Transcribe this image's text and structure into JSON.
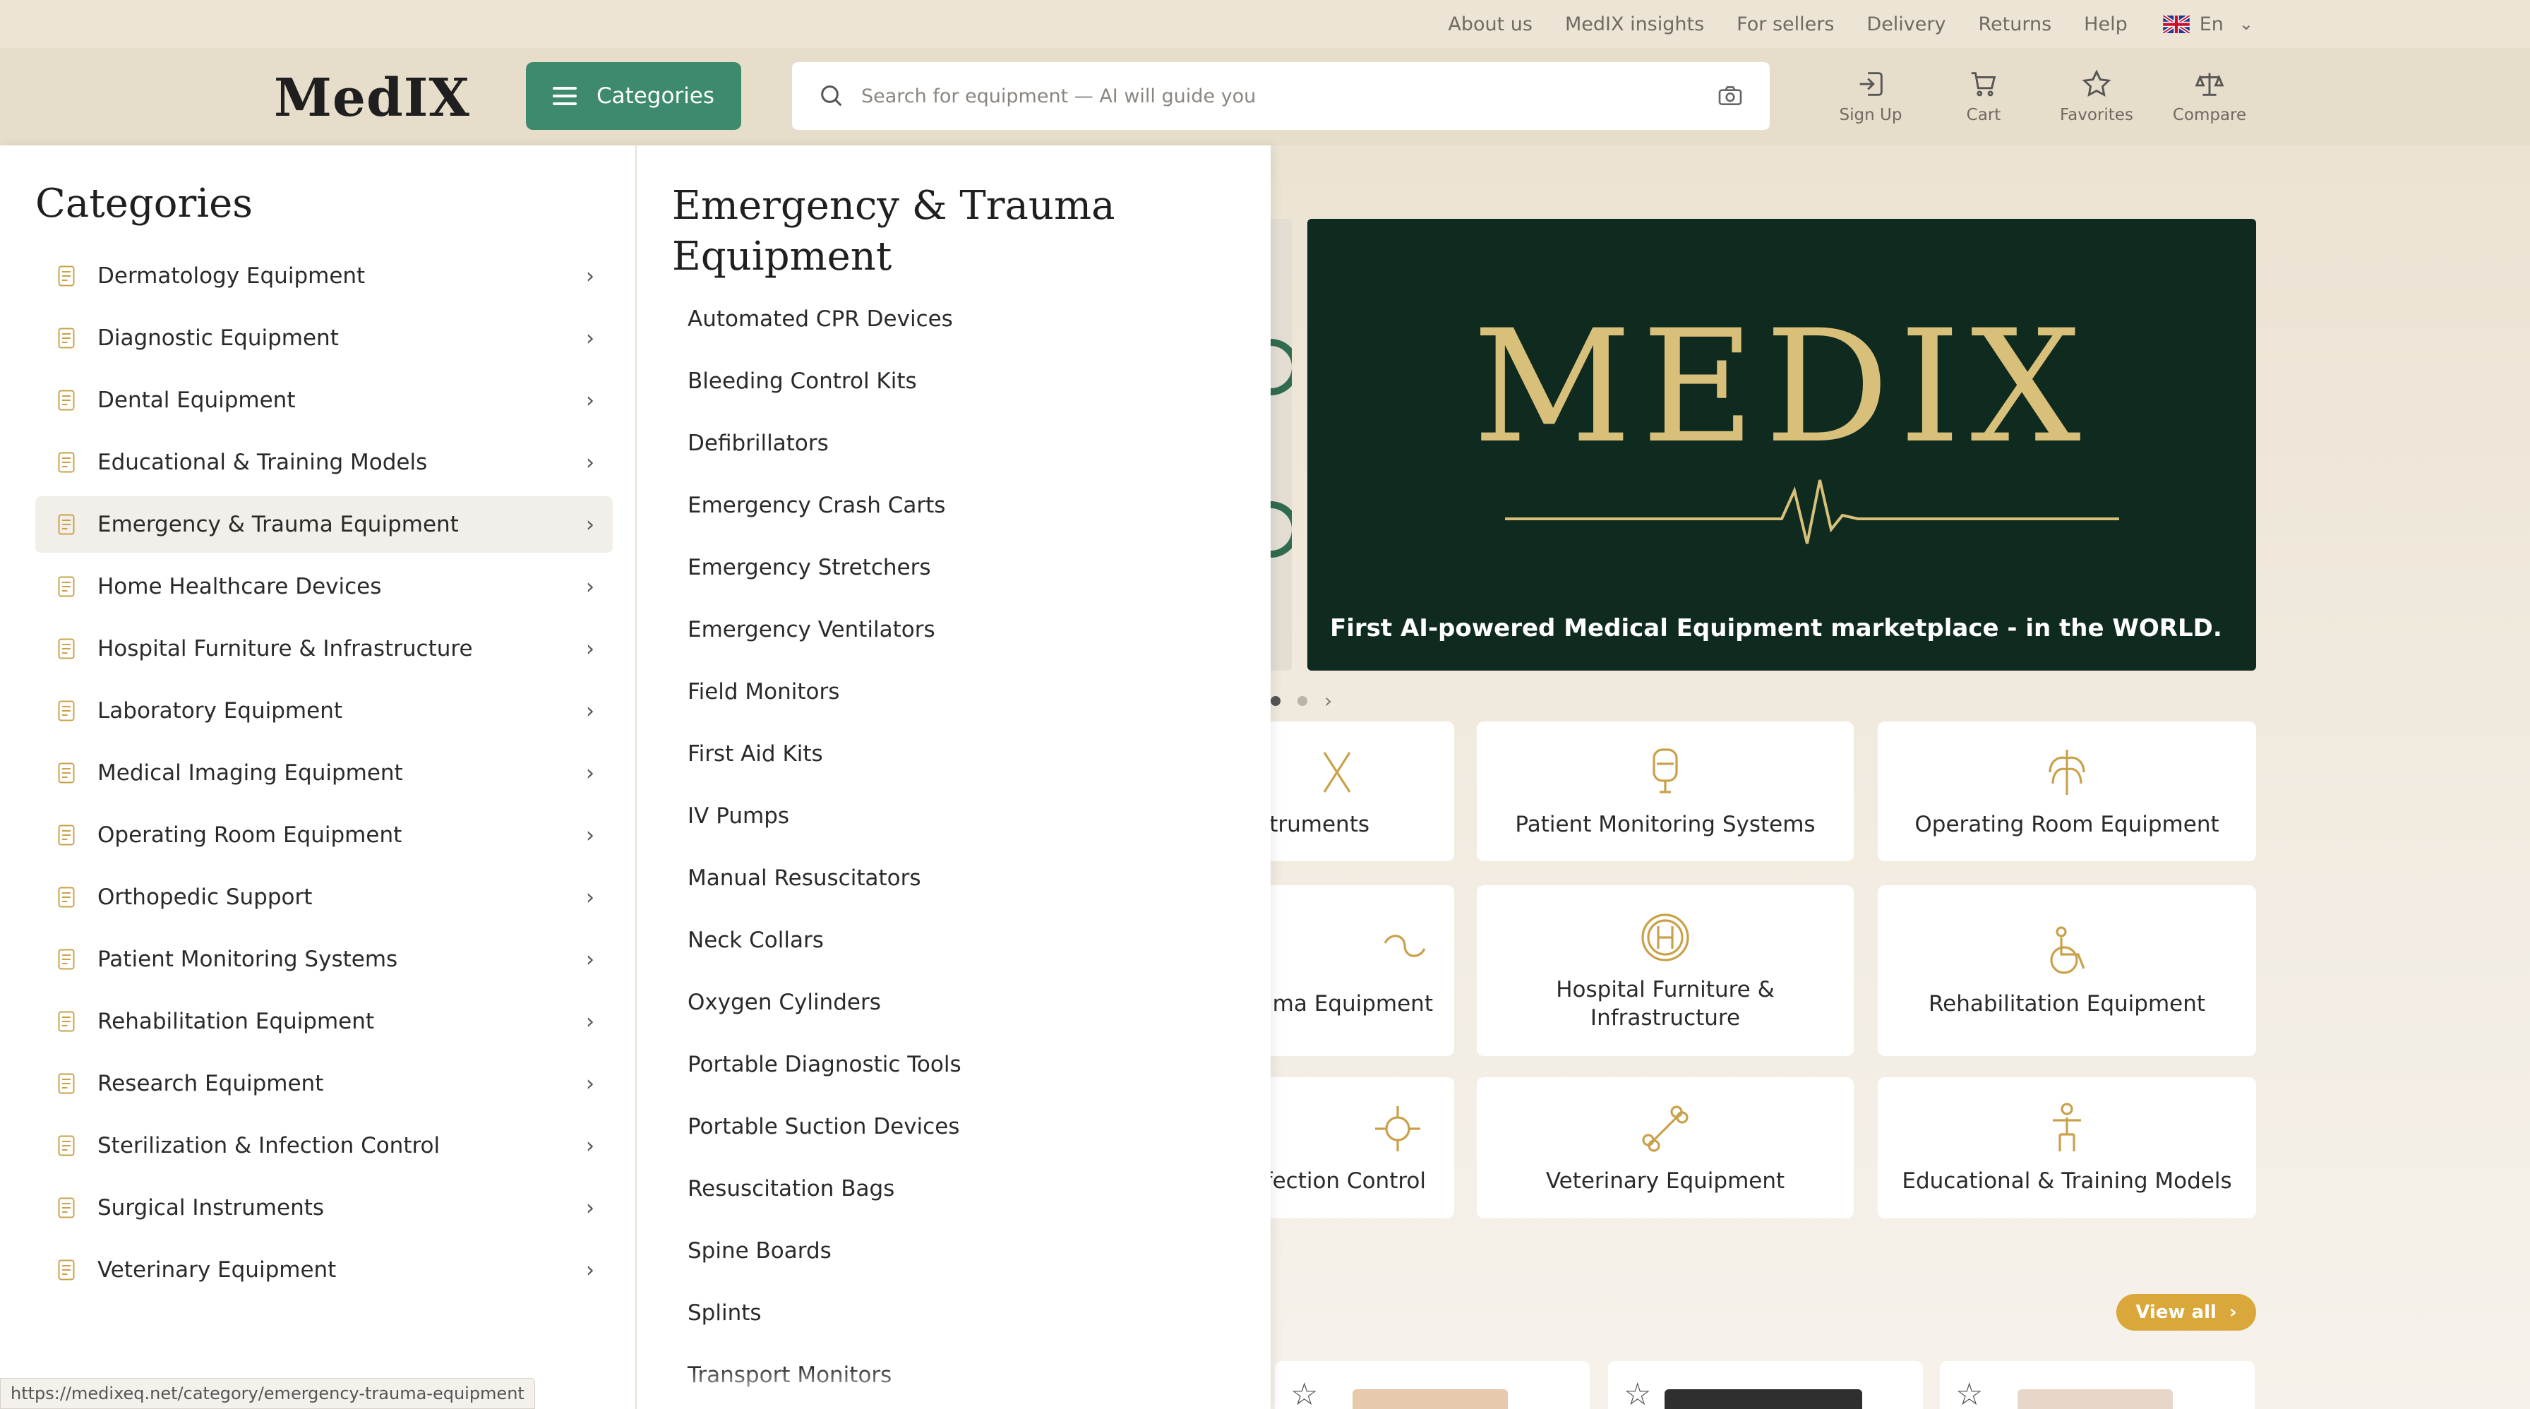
{
  "top_links": [
    "About us",
    "MedIX insights",
    "For sellers",
    "Delivery",
    "Returns",
    "Help"
  ],
  "language": "En",
  "header": {
    "logo": "MedIX",
    "categories_button": "Categories",
    "search_placeholder": "Search for equipment — AI will guide you",
    "icons": [
      {
        "label": "Sign Up",
        "icon": "sign-in-icon"
      },
      {
        "label": "Cart",
        "icon": "cart-icon"
      },
      {
        "label": "Favorites",
        "icon": "star-icon"
      },
      {
        "label": "Compare",
        "icon": "compare-scale-icon"
      }
    ]
  },
  "colors": {
    "accent_green": "#3d8a6d",
    "gold": "#c9a14a",
    "hero_bg": "#0f2a1f",
    "view_all": "#d9a73a"
  },
  "hero": {
    "title": "MEDIX",
    "tagline": "First AI-powered Medical Equipment marketplace - in the WORLD."
  },
  "category_cards": [
    {
      "label": "struments"
    },
    {
      "label": "Patient Monitoring Systems"
    },
    {
      "label": "Operating Room Equipment"
    },
    {
      "label": "uma Equipment"
    },
    {
      "label": "Hospital Furniture & Infrastructure"
    },
    {
      "label": "Rehabilitation Equipment"
    },
    {
      "label": "fection Control"
    },
    {
      "label": "Veterinary Equipment"
    },
    {
      "label": "Educational & Training Models"
    }
  ],
  "view_all": "View all",
  "panel": {
    "title": "Categories",
    "items": [
      "Dermatology Equipment",
      "Diagnostic Equipment",
      "Dental Equipment",
      "Educational & Training Models",
      "Emergency & Trauma Equipment",
      "Home Healthcare Devices",
      "Hospital Furniture & Infrastructure",
      "Laboratory Equipment",
      "Medical Imaging Equipment",
      "Operating Room Equipment",
      "Orthopedic Support",
      "Patient Monitoring Systems",
      "Rehabilitation Equipment",
      "Research Equipment",
      "Sterilization & Infection Control",
      "Surgical Instruments",
      "Veterinary Equipment"
    ],
    "active_index": 4,
    "subcategory_title": "Emergency & Trauma Equipment",
    "subcategories": [
      "Automated CPR Devices",
      "Bleeding Control Kits",
      "Defibrillators",
      "Emergency Crash Carts",
      "Emergency Stretchers",
      "Emergency Ventilators",
      "Field Monitors",
      "First Aid Kits",
      "IV Pumps",
      "Manual Resuscitators",
      "Neck Collars",
      "Oxygen Cylinders",
      "Portable Diagnostic Tools",
      "Portable Suction Devices",
      "Resuscitation Bags",
      "Spine Boards",
      "Splints",
      "Transport Monitors"
    ]
  },
  "status_url": "https://medixeq.net/category/emergency-trauma-equipment"
}
